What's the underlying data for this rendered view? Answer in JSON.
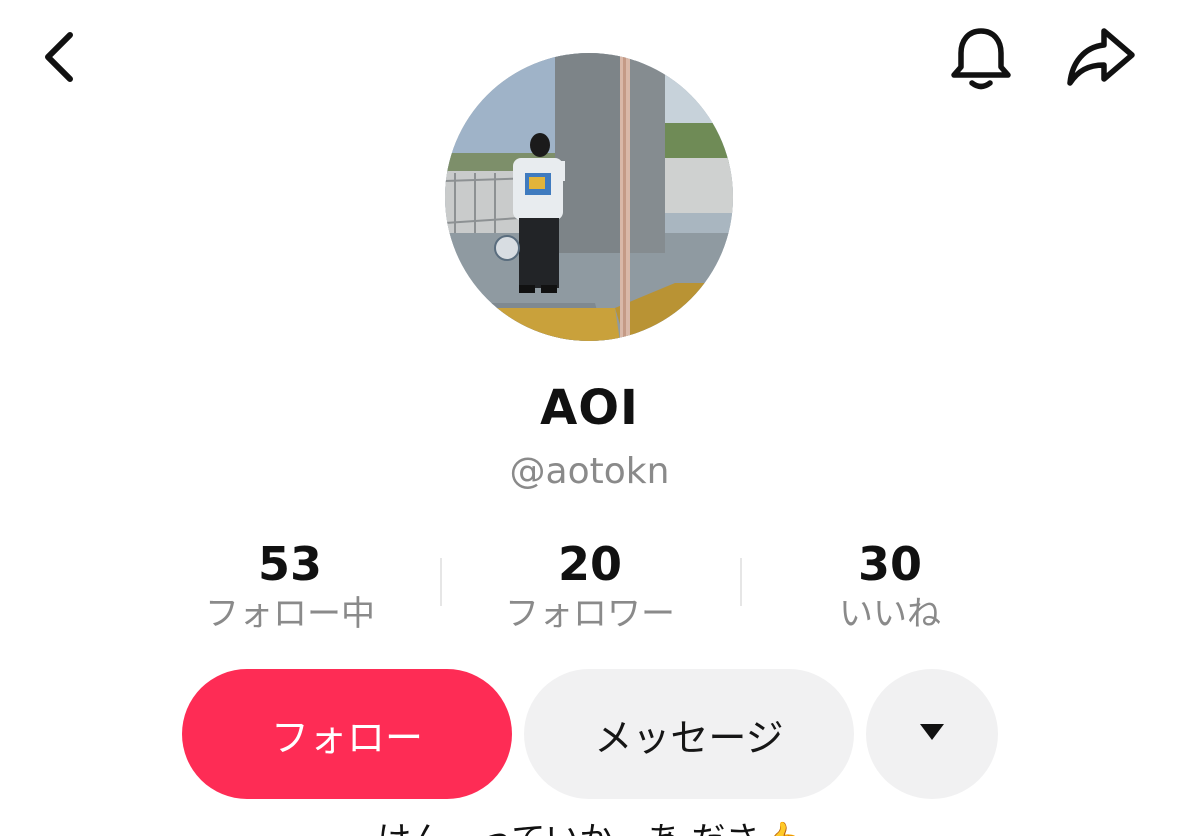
{
  "nav": {
    "back_icon": "chevron-left-icon",
    "notification_icon": "bell-icon",
    "share_icon": "share-arrow-icon"
  },
  "profile": {
    "display_name": "AOI",
    "username": "@aotokn"
  },
  "stats": {
    "following": {
      "value": "53",
      "label": "フォロー中"
    },
    "followers": {
      "value": "20",
      "label": "フォロワー"
    },
    "likes": {
      "value": "30",
      "label": "いいね"
    }
  },
  "actions": {
    "follow_label": "フォロー",
    "message_label": "メッセージ",
    "more_icon": "caret-down-icon"
  },
  "bio": {
    "text": "けんーっていか。あ.ださ👍"
  },
  "colors": {
    "follow_button": "#fe2c55",
    "secondary_button": "#f1f1f2",
    "primary_text": "#111111",
    "secondary_text": "#8a8a8a"
  }
}
